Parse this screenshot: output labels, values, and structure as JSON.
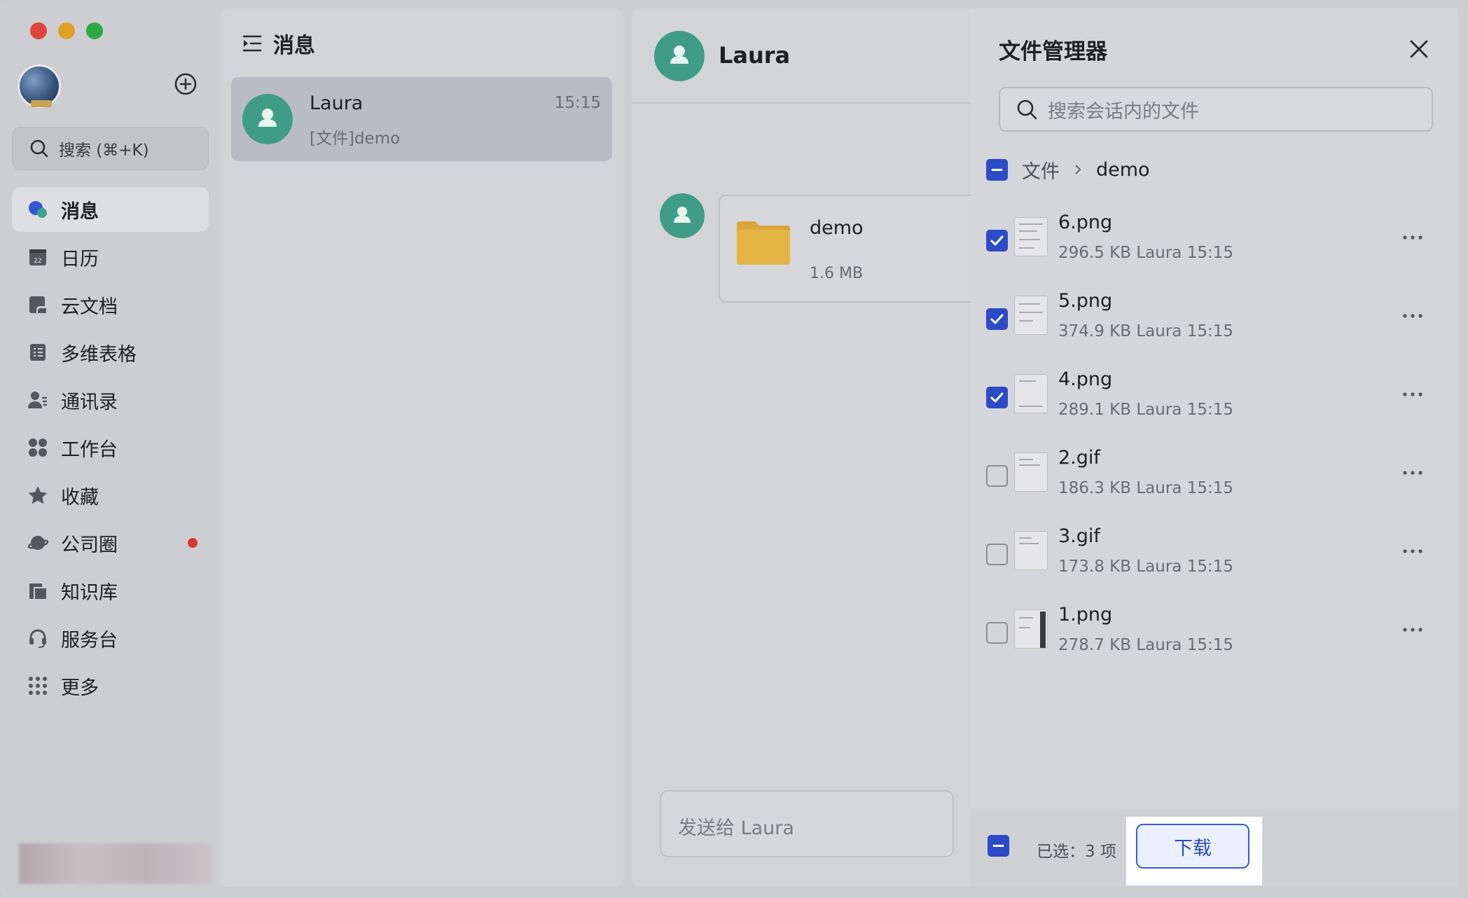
{
  "sidebar": {
    "search_placeholder": "搜索 (⌘+K)",
    "items": [
      {
        "label": "消息",
        "icon": "chat-bubble-icon",
        "active": true
      },
      {
        "label": "日历",
        "icon": "calendar-icon"
      },
      {
        "label": "云文档",
        "icon": "cloud-doc-icon"
      },
      {
        "label": "多维表格",
        "icon": "base-table-icon"
      },
      {
        "label": "通讯录",
        "icon": "contacts-icon"
      },
      {
        "label": "工作台",
        "icon": "workplace-icon"
      },
      {
        "label": "收藏",
        "icon": "star-icon"
      },
      {
        "label": "公司圈",
        "icon": "planet-icon",
        "badge": "red-dot"
      },
      {
        "label": "知识库",
        "icon": "wiki-icon"
      },
      {
        "label": "服务台",
        "icon": "headset-icon"
      },
      {
        "label": "更多",
        "icon": "grid-dots-icon"
      }
    ]
  },
  "chat_list": {
    "title": "消息",
    "items": [
      {
        "name": "Laura",
        "time": "15:15",
        "preview": "[文件]demo"
      }
    ]
  },
  "conversation": {
    "contact_name": "Laura",
    "message": {
      "file_name": "demo",
      "file_size": "1.6 MB"
    },
    "input_placeholder": "发送给 Laura"
  },
  "file_manager": {
    "title": "文件管理器",
    "search_placeholder": "搜索会话内的文件",
    "breadcrumb": [
      "文件",
      "demo"
    ],
    "files": [
      {
        "name": "6.png",
        "size": "296.5 KB",
        "sender": "Laura",
        "time": "15:15",
        "checked": true
      },
      {
        "name": "5.png",
        "size": "374.9 KB",
        "sender": "Laura",
        "time": "15:15",
        "checked": true
      },
      {
        "name": "4.png",
        "size": "289.1 KB",
        "sender": "Laura",
        "time": "15:15",
        "checked": true
      },
      {
        "name": "2.gif",
        "size": "186.3 KB",
        "sender": "Laura",
        "time": "15:15",
        "checked": false
      },
      {
        "name": "3.gif",
        "size": "173.8 KB",
        "sender": "Laura",
        "time": "15:15",
        "checked": false
      },
      {
        "name": "1.png",
        "size": "278.7 KB",
        "sender": "Laura",
        "time": "15:15",
        "checked": false
      }
    ],
    "selected_label": "已选：3 项",
    "download_label": "下载",
    "accent_color": "#2c4bc6"
  }
}
